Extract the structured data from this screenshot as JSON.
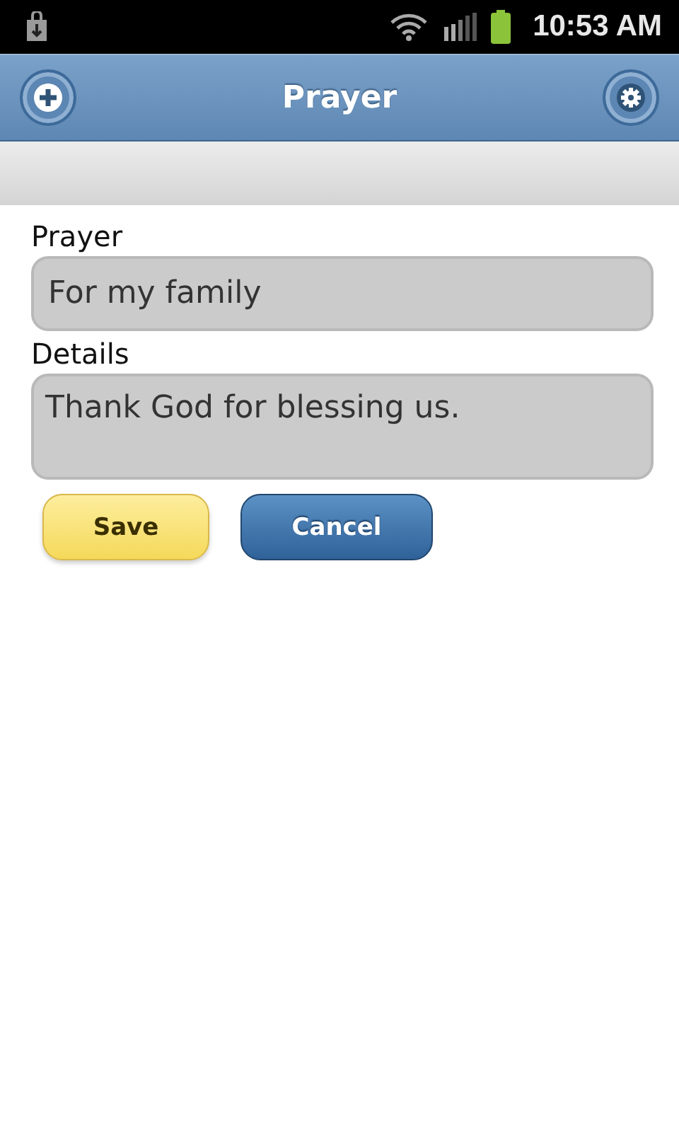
{
  "status_bar": {
    "time": "10:53 AM"
  },
  "header": {
    "title": "Prayer"
  },
  "fields": [
    {
      "label": "Prayer",
      "value": "For my family",
      "kind": "line"
    },
    {
      "label": "Details",
      "value": "Thank God for blessing us.",
      "kind": "area"
    }
  ],
  "buttons": [
    {
      "label": "Save",
      "kind": "primary"
    },
    {
      "label": "Cancel",
      "kind": "secondary"
    }
  ]
}
